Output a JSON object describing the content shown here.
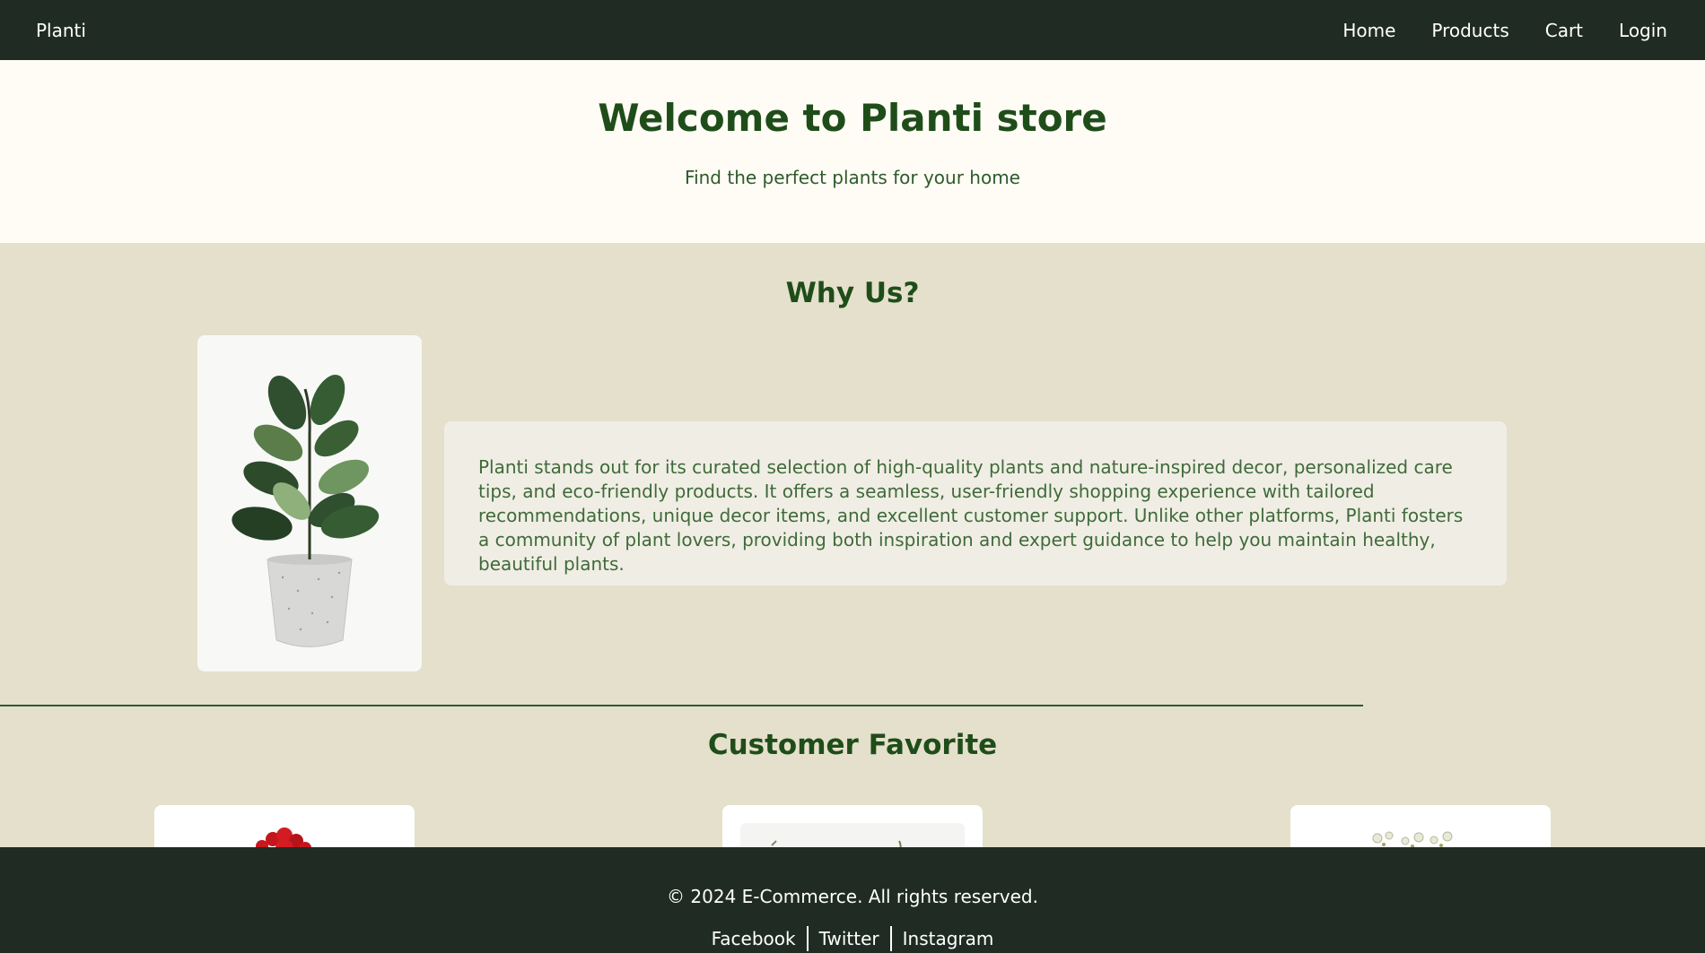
{
  "nav": {
    "brand": "Planti",
    "links": [
      "Home",
      "Products",
      "Cart",
      "Login"
    ]
  },
  "hero": {
    "title": "Welcome to Planti store",
    "subtitle": "Find the perfect plants for your home"
  },
  "why_us": {
    "title": "Why Us?",
    "image_icon": "potted-plant-image",
    "text": "Planti stands out for its curated selection of high-quality plants and nature-inspired decor, personalized care tips, and eco-friendly products. It offers a seamless, user-friendly shopping experience with tailored recommendations, unique decor items, and excellent customer support. Unlike other platforms, Planti fosters a community of plant lovers, providing both inspiration and expert guidance to help you maintain healthy, beautiful plants."
  },
  "favorites": {
    "title": "Customer Favorite",
    "cards": [
      {
        "image_icon": "red-flower-image"
      },
      {
        "image_icon": "green-plant-image"
      },
      {
        "image_icon": "white-flower-image"
      }
    ]
  },
  "footer": {
    "copyright": "© 2024 E-Commerce. All rights reserved.",
    "social": [
      "Facebook",
      "Twitter",
      "Instagram"
    ]
  },
  "colors": {
    "nav_bg": "#202b24",
    "heading_green": "#1f4d1a",
    "section_bg": "#e4e0cb",
    "hero_bg": "#fefcf5"
  }
}
